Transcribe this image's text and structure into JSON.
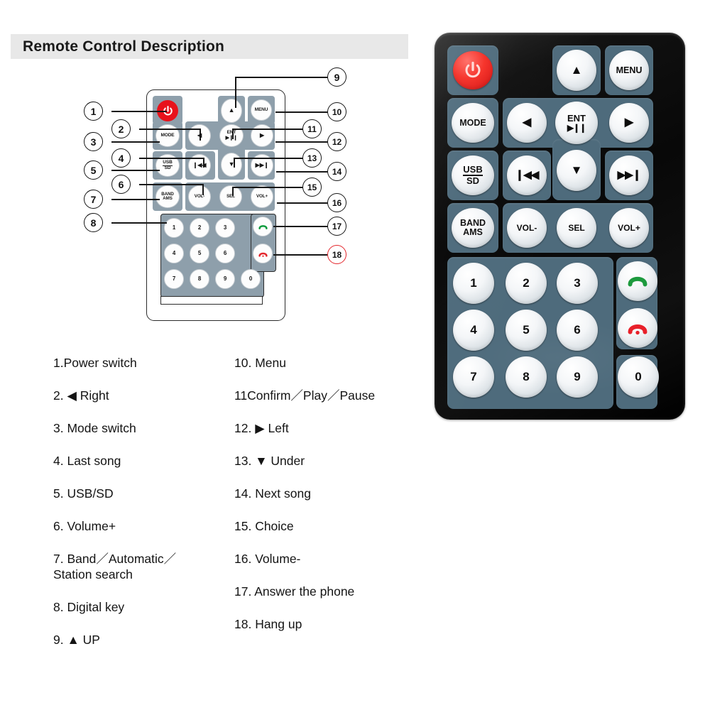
{
  "header": {
    "title": "Remote Control Description"
  },
  "diagram": {
    "buttons": [
      {
        "id": "power",
        "label": "",
        "icon": "power-icon"
      },
      {
        "id": "menu",
        "label": "MENU",
        "icon": ""
      },
      {
        "id": "up",
        "label": "▲",
        "icon": "arrow-up-icon"
      },
      {
        "id": "mode",
        "label": "MODE",
        "icon": ""
      },
      {
        "id": "left",
        "label": "◀",
        "icon": "arrow-left-icon"
      },
      {
        "id": "ent",
        "label": "ENT",
        "icon": "play-pause-icon",
        "sub": "▶❙❙"
      },
      {
        "id": "right",
        "label": "▶",
        "icon": "arrow-right-icon"
      },
      {
        "id": "usbsd",
        "label": "USB",
        "sub": "SD",
        "icon": ""
      },
      {
        "id": "prev",
        "label": "❙◀◀",
        "icon": "previous-track-icon"
      },
      {
        "id": "down",
        "label": "▼",
        "icon": "arrow-down-icon"
      },
      {
        "id": "next",
        "label": "▶▶❙",
        "icon": "next-track-icon"
      },
      {
        "id": "bandams",
        "label": "BAND",
        "sub": "AMS",
        "icon": ""
      },
      {
        "id": "volminus",
        "label": "VOL-",
        "icon": ""
      },
      {
        "id": "sel",
        "label": "SEL",
        "icon": ""
      },
      {
        "id": "volplus",
        "label": "VOL+",
        "icon": ""
      },
      {
        "id": "answer",
        "label": "",
        "icon": "phone-answer-icon"
      },
      {
        "id": "hangup",
        "label": "",
        "icon": "phone-hangup-icon"
      }
    ],
    "keypad": [
      "1",
      "2",
      "3",
      "4",
      "5",
      "6",
      "7",
      "8",
      "9",
      "0"
    ],
    "callouts": [
      {
        "n": "1"
      },
      {
        "n": "2"
      },
      {
        "n": "3"
      },
      {
        "n": "4"
      },
      {
        "n": "5"
      },
      {
        "n": "6"
      },
      {
        "n": "7"
      },
      {
        "n": "8"
      },
      {
        "n": "9"
      },
      {
        "n": "10"
      },
      {
        "n": "11"
      },
      {
        "n": "12"
      },
      {
        "n": "13"
      },
      {
        "n": "14"
      },
      {
        "n": "15"
      },
      {
        "n": "16"
      },
      {
        "n": "17"
      },
      {
        "n": "18"
      }
    ],
    "callout_colors": {
      "default": "#161616",
      "highlight": "#e4262c"
    }
  },
  "legend": {
    "left": [
      "1.Power switch",
      "2. ◀ Right",
      "3. Mode switch",
      "4. Last song",
      "5. USB/SD",
      "6. Volume+",
      "7. Band／Automatic／\nStation search",
      "8. Digital key",
      "9. ▲ UP"
    ],
    "right": [
      "10. Menu",
      "11Confirm／Play／Pause",
      "12. ▶  Left",
      "13. ▼  Under",
      "14. Next song",
      "15. Choice",
      "16. Volume-",
      "17. Answer the phone",
      "18. Hang up"
    ]
  },
  "photo": {
    "buttons": [
      {
        "id": "power",
        "label": "",
        "icon": "power-icon"
      },
      {
        "id": "up",
        "label": "▲",
        "icon": "arrow-up-icon"
      },
      {
        "id": "menu",
        "label": "MENU",
        "icon": ""
      },
      {
        "id": "mode",
        "label": "MODE",
        "icon": ""
      },
      {
        "id": "left",
        "label": "◀",
        "icon": "arrow-left-icon"
      },
      {
        "id": "ent",
        "label": "ENT",
        "sub": "▶❙❙",
        "icon": "play-pause-icon"
      },
      {
        "id": "right",
        "label": "▶",
        "icon": "arrow-right-icon"
      },
      {
        "id": "usbsd",
        "label": "USB",
        "sub": "SD",
        "icon": ""
      },
      {
        "id": "prev",
        "label": "❙◀◀",
        "icon": "previous-track-icon"
      },
      {
        "id": "down",
        "label": "▼",
        "icon": "arrow-down-icon"
      },
      {
        "id": "next",
        "label": "▶▶❙",
        "icon": "next-track-icon"
      },
      {
        "id": "bandams",
        "label": "BAND",
        "sub": "AMS",
        "icon": ""
      },
      {
        "id": "volminus",
        "label": "VOL-",
        "icon": ""
      },
      {
        "id": "sel",
        "label": "SEL",
        "icon": ""
      },
      {
        "id": "volplus",
        "label": "VOL+",
        "icon": ""
      },
      {
        "id": "answer",
        "label": "",
        "icon": "phone-answer-icon"
      },
      {
        "id": "hangup",
        "label": "",
        "icon": "phone-hangup-icon"
      }
    ],
    "keypad": [
      "1",
      "2",
      "3",
      "4",
      "5",
      "6",
      "7",
      "8",
      "9",
      "0"
    ],
    "colors": {
      "body": "#0b0b0b",
      "pad": "#4e6b7c",
      "button": "#f2f5f7",
      "power": "#f62d24",
      "answer": "#1d9a3e",
      "hangup": "#e8202a"
    }
  }
}
